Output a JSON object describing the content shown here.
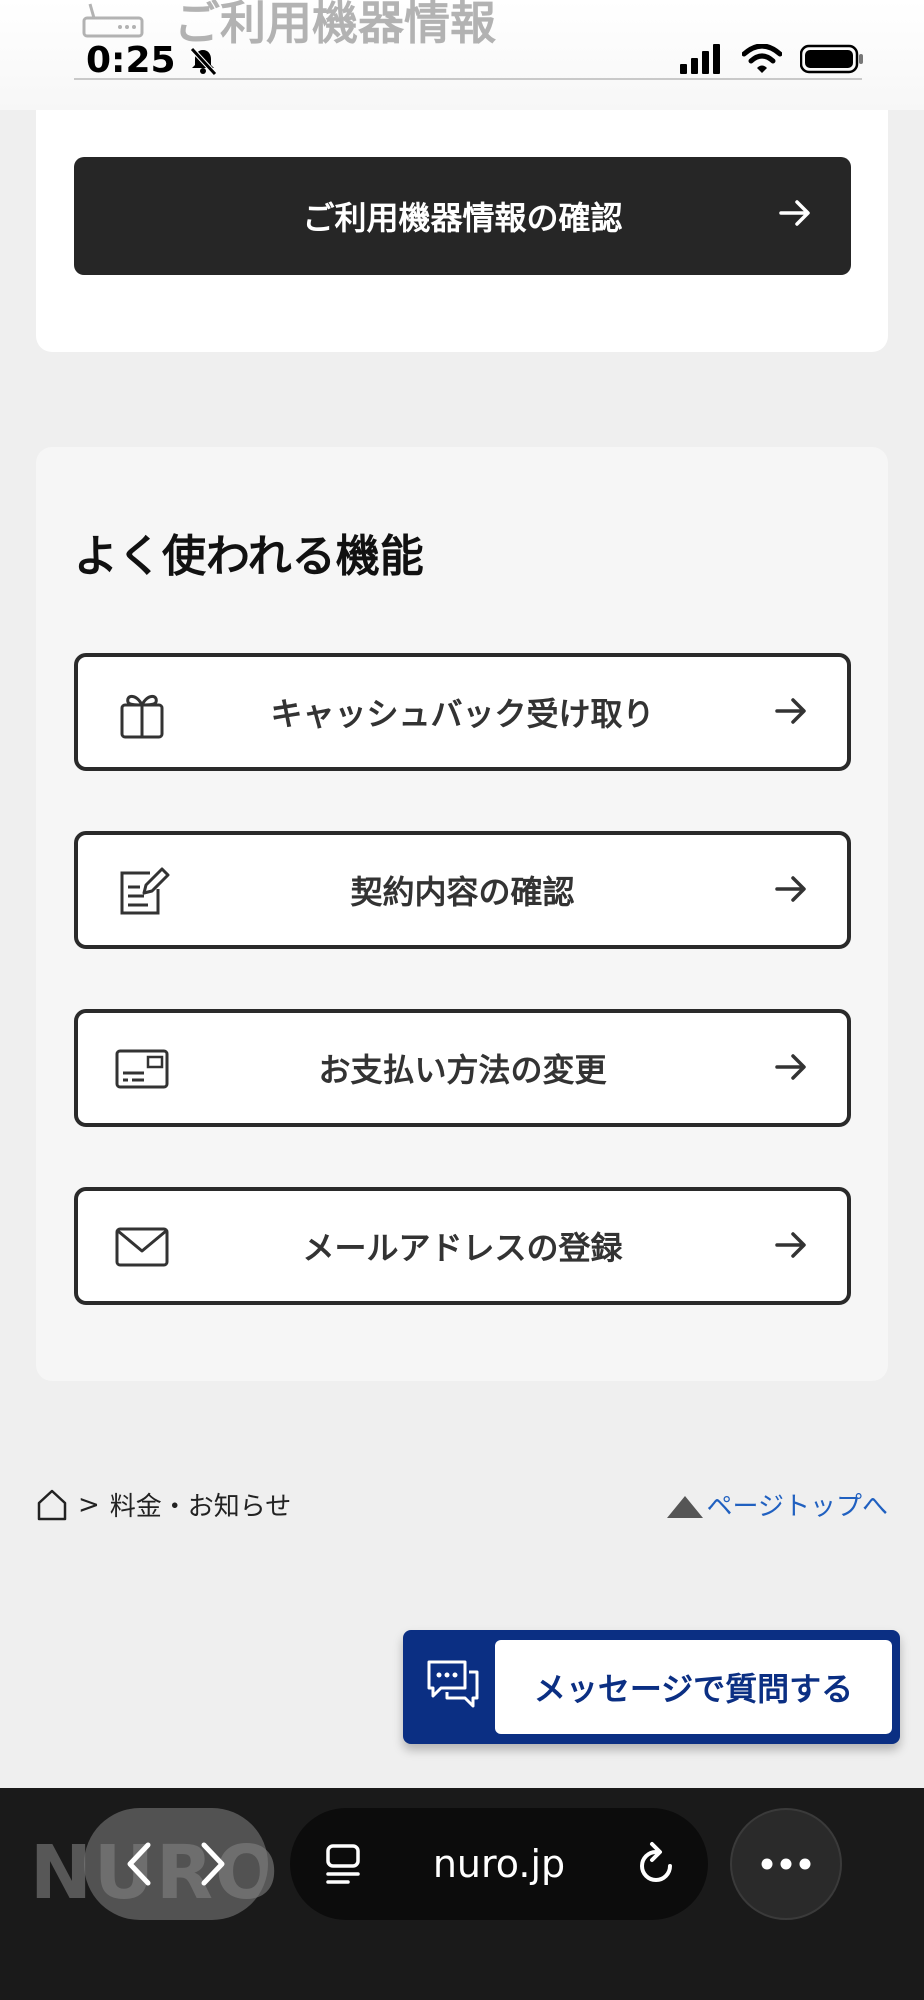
{
  "status_bar": {
    "time": "0:25",
    "icons": [
      "bell-slash-icon",
      "signal-icon",
      "wifi-icon",
      "battery-icon"
    ]
  },
  "header": {
    "faded_title": "ご利用機器情報",
    "icon": "router-icon"
  },
  "device_card": {
    "button_label": "ご利用機器情報の確認"
  },
  "features": {
    "title": "よく使われる機能",
    "items": [
      {
        "label": "キャッシュバック受け取り",
        "icon": "gift-icon"
      },
      {
        "label": "契約内容の確認",
        "icon": "contract-edit-icon"
      },
      {
        "label": "お支払い方法の変更",
        "icon": "credit-card-icon"
      },
      {
        "label": "メールアドレスの登録",
        "icon": "mail-icon"
      }
    ]
  },
  "breadcrumb": {
    "separator": ">",
    "current": "料金・お知らせ"
  },
  "page_top": {
    "label": "ページトップへ"
  },
  "message_button": {
    "label": "メッセージで質問する"
  },
  "browser": {
    "brand_ghost": "NURO",
    "url": "nuro.jp"
  },
  "colors": {
    "dark_button": "#262626",
    "link": "#2060c0",
    "message_navy": "#0b2f83"
  }
}
